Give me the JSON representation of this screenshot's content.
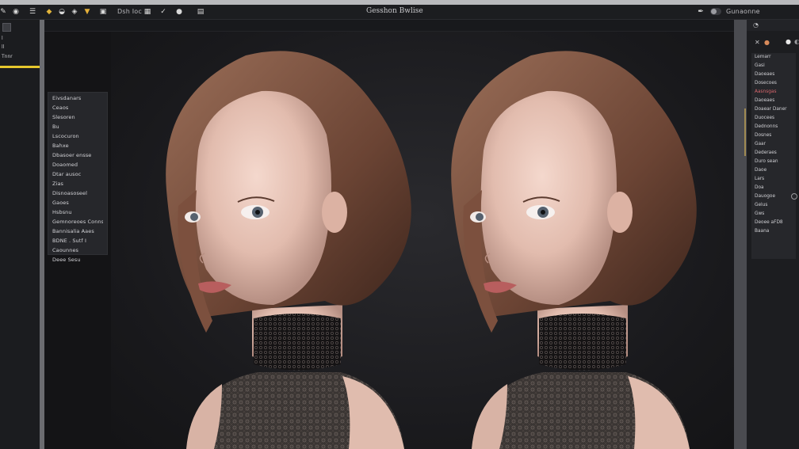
{
  "app": {
    "title": "Gesshon Bwlise"
  },
  "toolbar": {
    "left_label": "Dsh Ioc",
    "right_label": "Gunaonne",
    "icons": [
      "wrench-icon",
      "layers-icon",
      "menu-icon",
      "brush-icon",
      "bucket-icon",
      "shield-icon",
      "image-icon",
      "check-icon",
      "blob-icon",
      "grid-icon",
      "pen-icon",
      "toggle-icon"
    ]
  },
  "leftbar": {
    "lines": [
      "l",
      "ll",
      "Tnnr"
    ],
    "accent_color": "#e6c72d"
  },
  "properties": {
    "lines": [
      "Eivsdanars",
      "Ceaos",
      "Slesoren",
      "Bu",
      "Lscocuron",
      "Bahxe",
      "Dbasoer ensse",
      "Doaomed",
      "Dtar ausoc",
      "Zias",
      "Disnoasoseel",
      "Gaoes",
      "Hsbsnu",
      "Gemnoreoes Conns",
      "Bannisalia Aaes",
      "BDNE . Sutf I",
      "Caounnes",
      "Deee Sesu"
    ]
  },
  "rightpanel": {
    "header_icons": [
      "close-icon",
      "dot-icon"
    ],
    "items": [
      {
        "text": "Lemarr",
        "color": "normal"
      },
      {
        "text": "Gasi",
        "color": "normal"
      },
      {
        "text": "Daoeaes",
        "color": "normal"
      },
      {
        "text": "Dosecoes",
        "color": "normal"
      },
      {
        "text": "Aasnsgas",
        "color": "red"
      },
      {
        "text": "Daoeaes",
        "color": "normal"
      },
      {
        "text": "Doaear Daner",
        "color": "normal"
      },
      {
        "text": "Duocees",
        "color": "normal"
      },
      {
        "text": "Dednonns",
        "color": "normal"
      },
      {
        "text": "Dosnes",
        "color": "normal"
      },
      {
        "text": "Gaar",
        "color": "normal"
      },
      {
        "text": "Dederaes",
        "color": "normal"
      },
      {
        "text": "Duro sean",
        "color": "normal"
      },
      {
        "text": "Daoe",
        "color": "normal"
      },
      {
        "text": "Lars",
        "color": "normal"
      },
      {
        "text": "Doa",
        "color": "normal"
      },
      {
        "text": "Dauogoe",
        "color": "normal"
      },
      {
        "text": "Gelus",
        "color": "normal"
      },
      {
        "text": "Gws",
        "color": "normal"
      },
      {
        "text": "Deoee aFD8",
        "color": "normal"
      },
      {
        "text": "Baana",
        "color": "normal"
      }
    ]
  },
  "viewport": {
    "description_left": "portrait-left",
    "description_right": "portrait-right"
  }
}
